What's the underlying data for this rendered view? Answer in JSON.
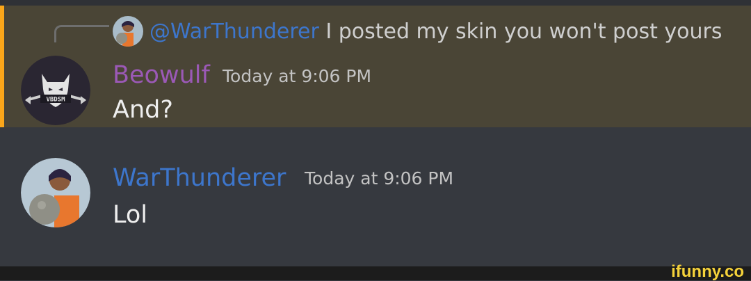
{
  "reply": {
    "mention": "@WarThunderer",
    "text": " I posted my skin you won't post yours",
    "avatar_icon": "anime-character-avatar-icon"
  },
  "messages": [
    {
      "author": "Beowulf",
      "timestamp": "Today at 9:06 PM",
      "text": "And?",
      "author_color": "#9b59b6",
      "avatar_icon": "wolf-emblem-avatar-icon",
      "avatar_label": "VBDSM",
      "highlighted": true,
      "highlight_color": "#faa61a"
    },
    {
      "author": "WarThunderer",
      "timestamp": "Today at 9:06 PM",
      "text": "Lol",
      "author_color": "#3d76cc",
      "avatar_icon": "anime-character-avatar-icon"
    }
  ],
  "watermark": "ifunny.co"
}
